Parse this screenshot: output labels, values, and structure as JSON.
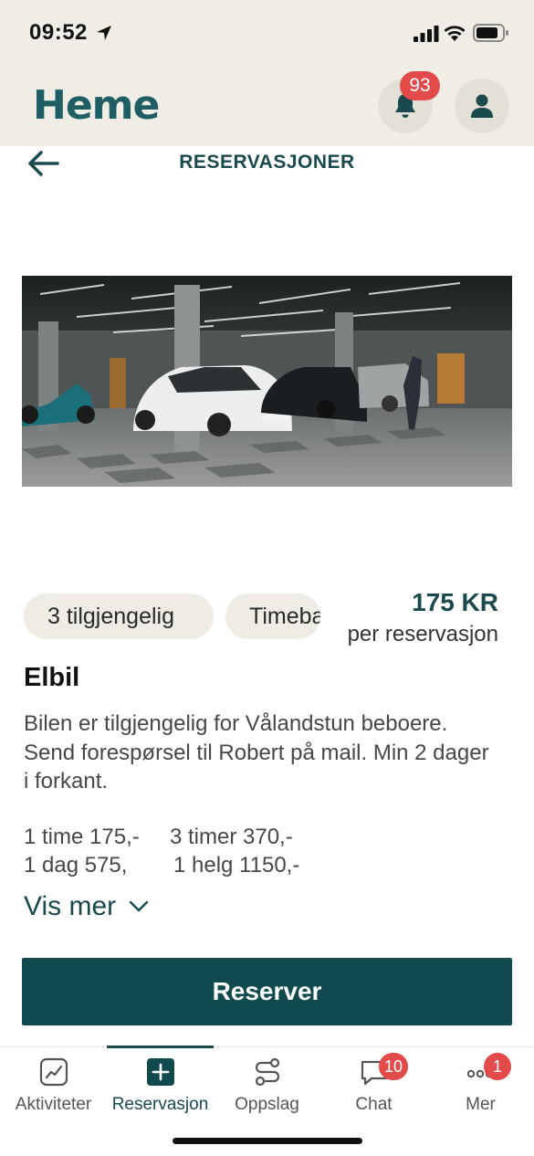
{
  "status_bar": {
    "time": "09:52"
  },
  "header": {
    "logo": "Heme",
    "notification_count": "93"
  },
  "page": {
    "title": "RESERVASJONER"
  },
  "listing": {
    "chips": [
      "3 tilgjengelig",
      "Timebasert"
    ],
    "price": "175 KR",
    "price_unit": "per reservasjon",
    "title": "Elbil",
    "description": "Bilen er tilgjengelig for Vålandstun beboere. Send forespørsel til Robert på mail. Min 2 dager i forkant.",
    "rates": {
      "r1": "1 time 175,-",
      "r2": "3 timer 370,-",
      "r3": "1 dag 575,",
      "r4": "1 helg 1150,-"
    },
    "show_more": "Vis mer",
    "reserve_button": "Reserver"
  },
  "nav": {
    "items": [
      {
        "label": "Aktiviteter",
        "icon": "chart-icon"
      },
      {
        "label": "Reservasjon",
        "icon": "plus-square-icon"
      },
      {
        "label": "Oppslag",
        "icon": "route-icon"
      },
      {
        "label": "Chat",
        "icon": "chat-icon",
        "badge": "10"
      },
      {
        "label": "Mer",
        "icon": "more-icon",
        "badge": "1"
      }
    ],
    "active_index": 1
  },
  "colors": {
    "primary": "#114a4e",
    "accent_text": "#1a4a4e",
    "badge": "#e24b4a",
    "header_bg": "#efede6"
  }
}
